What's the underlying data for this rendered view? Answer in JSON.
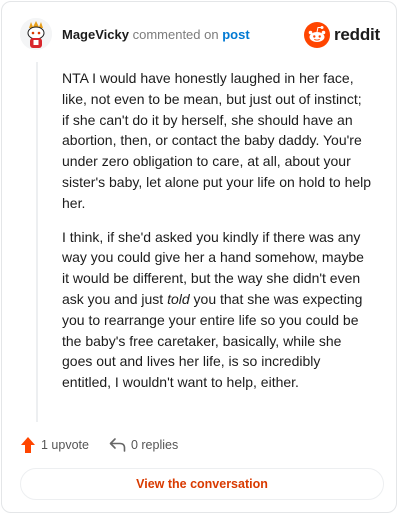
{
  "comment": {
    "username": "MageVicky",
    "action_text": "commented on",
    "target_text": "post",
    "brand": "reddit",
    "paragraphs": [
      {
        "text": "NTA I would have honestly laughed in her face, like, not even to be mean, but just out of instinct; if she can't do it by herself, she should have an abortion, then, or contact the baby daddy. You're under zero obligation to care, at all, about your sister's baby, let alone put your life on hold to help her."
      },
      {
        "before": "I think, if she'd asked you kindly if there was any way you could give her a hand somehow, maybe it would be different, but the way she didn't even ask you and just ",
        "emphasis": "told",
        "after": " you that she was expecting you to rearrange your entire life so you could be the baby's free caretaker, basically, while she goes out and lives her life, is so incredibly entitled, I wouldn't want to help, either."
      }
    ]
  },
  "actions": {
    "upvote_label": "1 upvote",
    "replies_label": "0 replies"
  },
  "cta": {
    "label": "View the conversation"
  },
  "colors": {
    "accent": "#ff4500",
    "link": "#0079d3",
    "cta_text": "#d93a00"
  },
  "icons": {
    "avatar": "snoo-avatar-icon",
    "logo": "reddit-logo-icon",
    "upvote": "upvote-arrow-icon",
    "reply": "reply-arrow-icon"
  }
}
